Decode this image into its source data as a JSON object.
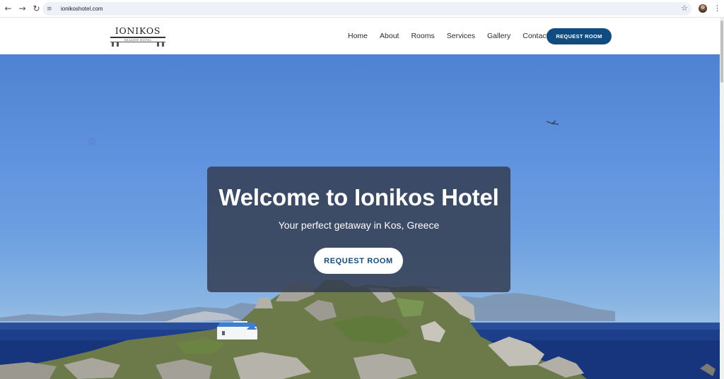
{
  "browser": {
    "back_icon": "arrow-left-icon",
    "forward_icon": "arrow-right-icon",
    "reload_icon": "reload-icon",
    "site_info_icon": "tune-icon",
    "url": "ionikoshotel.com",
    "bookmark_icon": "star-icon",
    "menu_icon": "kebab-menu-icon"
  },
  "header": {
    "logo": {
      "name": "IONIKOS",
      "subtitle": "SEASIDE HOTEL"
    },
    "nav": [
      {
        "label": "Home"
      },
      {
        "label": "About"
      },
      {
        "label": "Rooms"
      },
      {
        "label": "Services"
      },
      {
        "label": "Gallery"
      },
      {
        "label": "Contact"
      }
    ],
    "cta_label": "REQUEST ROOM"
  },
  "hero": {
    "title": "Welcome to Ionikos Hotel",
    "subtitle": "Your perfect getaway in Kos, Greece",
    "cta_label": "REQUEST ROOM"
  },
  "colors": {
    "brand": "#0f4c81",
    "panel": "#343e52",
    "sky": "#5d91de",
    "sea": "#1d3e8a"
  }
}
